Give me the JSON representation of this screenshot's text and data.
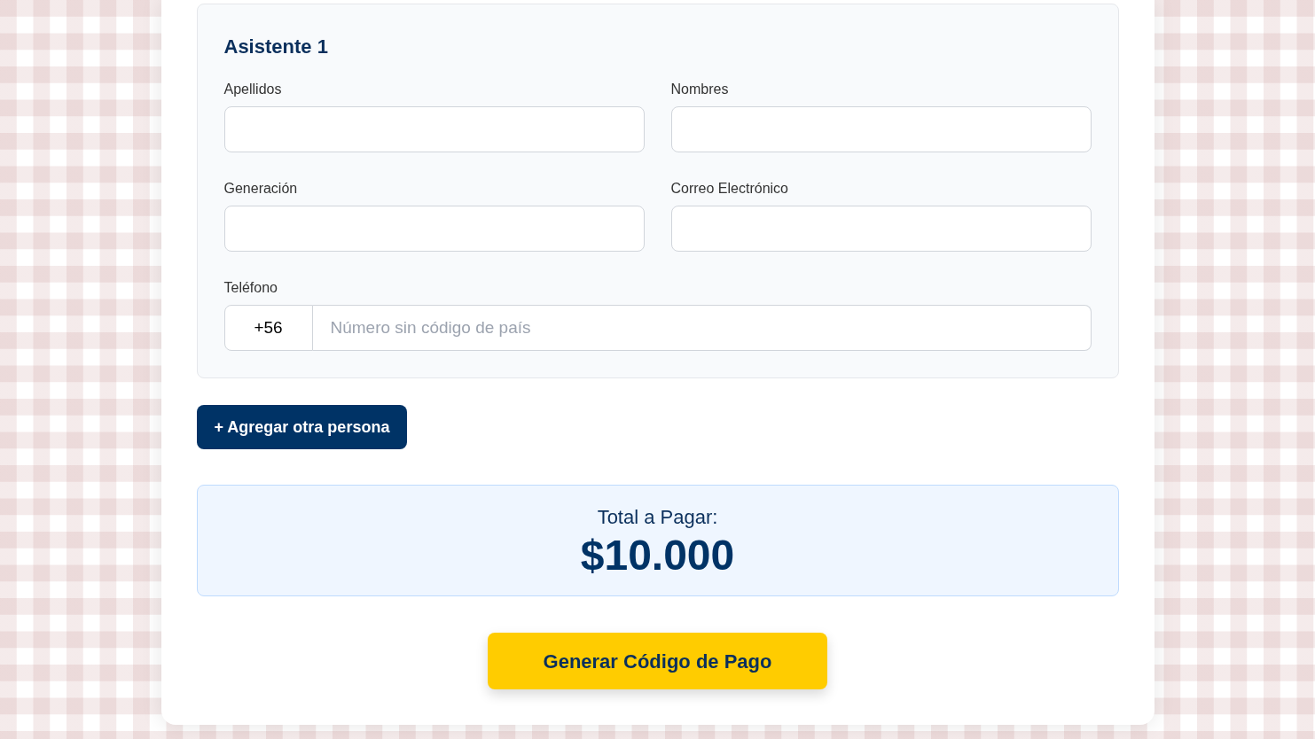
{
  "attendee": {
    "title": "Asistente 1",
    "fields": [
      {
        "label": "Apellidos"
      },
      {
        "label": "Nombres"
      },
      {
        "label": "Generación"
      },
      {
        "label": "Correo Electrónico"
      }
    ],
    "phone": {
      "label": "Teléfono",
      "prefix": "+56",
      "placeholder": "Número sin código de país"
    }
  },
  "add_button": {
    "label": "+ Agregar otra persona"
  },
  "total": {
    "label": "Total a Pagar:",
    "amount": "$10.000"
  },
  "submit_button": {
    "label": "Generar Código de Pago"
  }
}
